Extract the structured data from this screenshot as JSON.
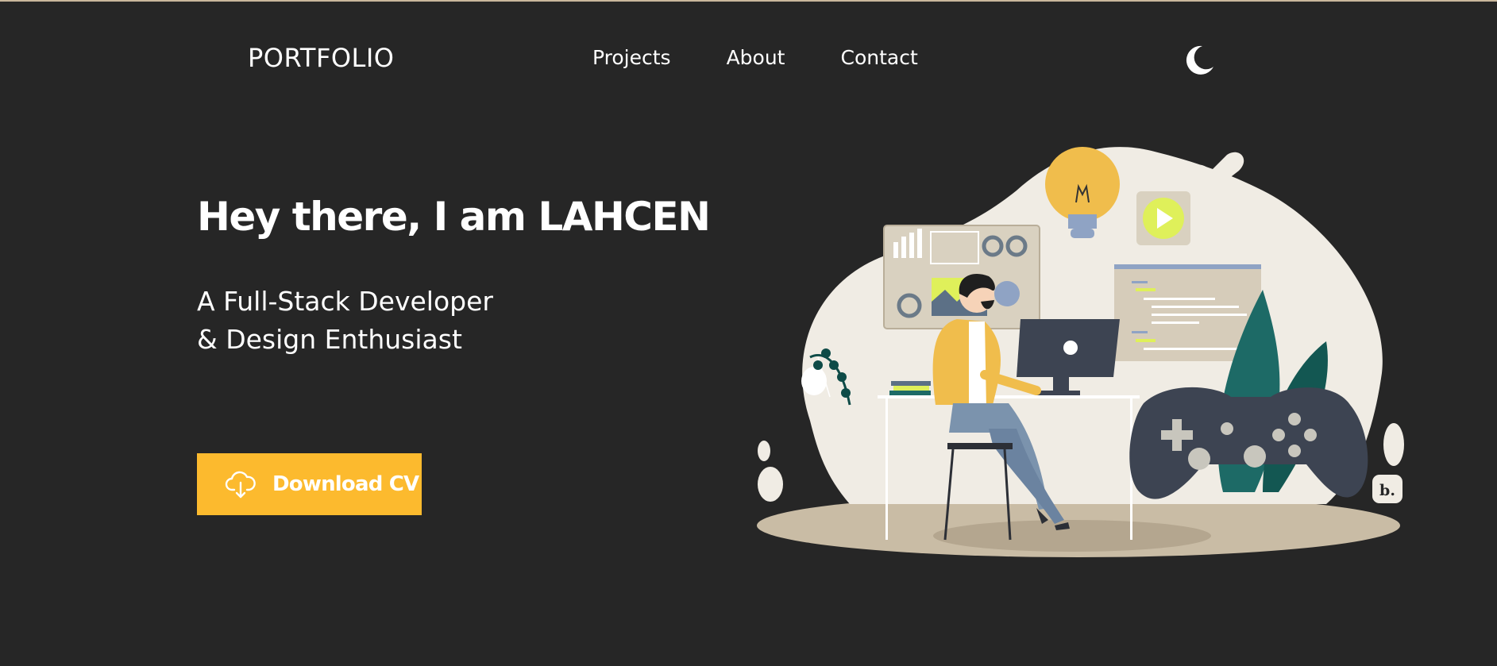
{
  "nav": {
    "logo": "PORTFOLIO",
    "links": [
      {
        "label": "Projects"
      },
      {
        "label": "About"
      },
      {
        "label": "Contact"
      }
    ],
    "theme_icon": "moon-icon"
  },
  "hero": {
    "title": "Hey there, I am LAHCEN",
    "subtitle_line1": "A Full-Stack Developer",
    "subtitle_line2": "& Design Enthusiast",
    "cv_button": {
      "label": "Download CV",
      "icon": "cloud-download-icon"
    }
  },
  "illustration": {
    "subject": "developer-at-desk-illustration",
    "badge_text": "b."
  },
  "colors": {
    "background": "#262626",
    "accent": "#fcba2e",
    "text": "#ffffff"
  }
}
